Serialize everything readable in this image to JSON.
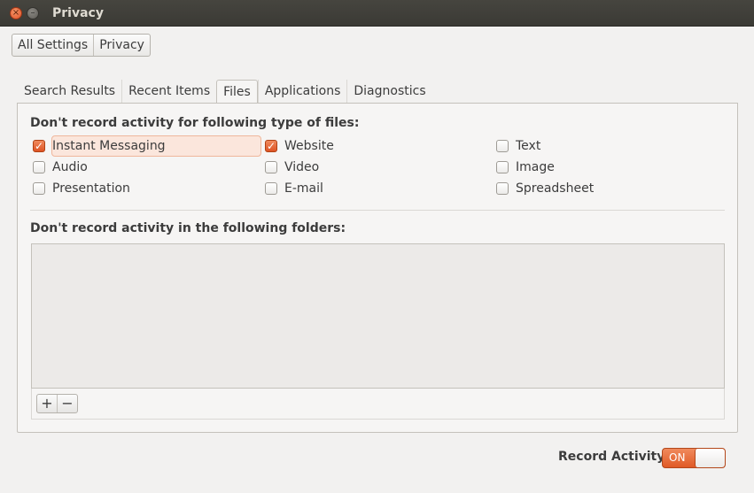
{
  "window": {
    "title": "Privacy",
    "close_glyph": "×",
    "minimize_glyph": "–",
    "close_icon": "close-icon",
    "minimize_icon": "minimize-icon"
  },
  "breadcrumb": [
    "All Settings",
    "Privacy"
  ],
  "tabs": [
    {
      "label": "Search Results",
      "active": false
    },
    {
      "label": "Recent Items",
      "active": false
    },
    {
      "label": "Files",
      "active": true
    },
    {
      "label": "Applications",
      "active": false
    },
    {
      "label": "Diagnostics",
      "active": false
    }
  ],
  "files": {
    "title": "Don't record activity for following type of files:",
    "items": [
      {
        "label": "Instant Messaging",
        "checked": true,
        "focused": true
      },
      {
        "label": "Website",
        "checked": true
      },
      {
        "label": "Text",
        "checked": false
      },
      {
        "label": "Audio",
        "checked": false
      },
      {
        "label": "Video",
        "checked": false
      },
      {
        "label": "Image",
        "checked": false
      },
      {
        "label": "Presentation",
        "checked": false
      },
      {
        "label": "E-mail",
        "checked": false
      },
      {
        "label": "Spreadsheet",
        "checked": false
      }
    ]
  },
  "folders": {
    "title": "Don't record activity in the following folders:",
    "add_label": "+",
    "remove_label": "−",
    "items": []
  },
  "record_activity": {
    "label": "Record Activity",
    "state_label": "ON",
    "on": true
  },
  "colors": {
    "accent": "#e05a26",
    "titlebar": "#3c3b37",
    "background": "#f2f1f0"
  }
}
